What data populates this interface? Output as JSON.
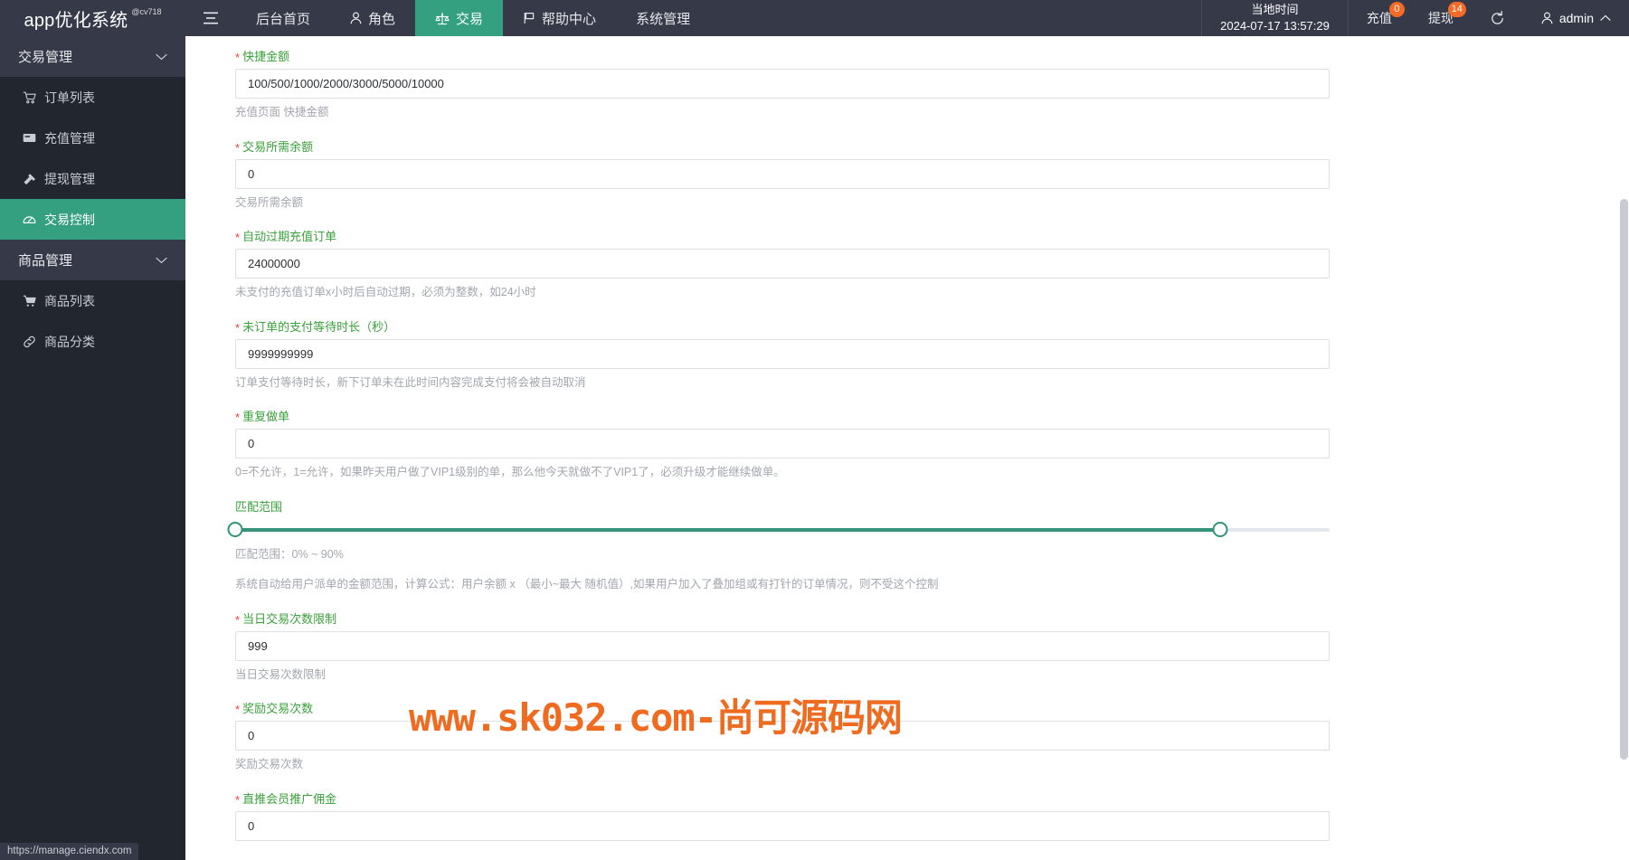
{
  "header": {
    "brand_title": "app优化系统",
    "brand_sup": "@cv718",
    "menu_icon": "hamburger-icon",
    "nav": [
      {
        "label": "后台首页",
        "icon": "",
        "active": false
      },
      {
        "label": "角色",
        "icon": "user-icon",
        "active": false
      },
      {
        "label": "交易",
        "icon": "scales-icon",
        "active": true
      },
      {
        "label": "帮助中心",
        "icon": "flag-icon",
        "active": false
      },
      {
        "label": "系统管理",
        "icon": "",
        "active": false
      }
    ],
    "clock_label": "当地时间",
    "clock_value": "2024-07-17 13:57:29",
    "recharge_label": "充值",
    "recharge_badge": "0",
    "withdraw_label": "提现",
    "withdraw_badge": "14",
    "refresh_icon": "refresh-icon",
    "user_label": "admin",
    "accent": "#35a07f",
    "badge_color": "#f56a24",
    "bar_color": "#363a48"
  },
  "sidebar": {
    "groups": [
      {
        "label": "交易管理",
        "items": [
          {
            "label": "订单列表",
            "icon": "cart-icon",
            "active": false
          },
          {
            "label": "充值管理",
            "icon": "card-icon",
            "active": false
          },
          {
            "label": "提现管理",
            "icon": "hammer-icon",
            "active": false
          },
          {
            "label": "交易控制",
            "icon": "gauge-icon",
            "active": true
          }
        ]
      },
      {
        "label": "商品管理",
        "items": [
          {
            "label": "商品列表",
            "icon": "cart-filled-icon",
            "active": false
          },
          {
            "label": "商品分类",
            "icon": "link-icon",
            "active": false
          }
        ]
      }
    ]
  },
  "form": {
    "fields": [
      {
        "type": "input",
        "required": true,
        "label": "快捷金额",
        "value": "100/500/1000/2000/3000/5000/10000",
        "help": "充值页面 快捷金额"
      },
      {
        "type": "input",
        "required": true,
        "label": "交易所需余额",
        "value": "0",
        "help": "交易所需余额"
      },
      {
        "type": "input",
        "required": true,
        "label": "自动过期充值订单",
        "value": "24000000",
        "help": "未支付的充值订单x小时后自动过期，必须为整数，如24小时"
      },
      {
        "type": "input",
        "required": true,
        "label": "未订单的支付等待时长（秒）",
        "value": "9999999999",
        "help": "订单支付等待时长，新下订单未在此时间内容完成支付将会被自动取消"
      },
      {
        "type": "input",
        "required": true,
        "label": "重复做单",
        "value": "0",
        "help": "0=不允许，1=允许，如果昨天用户做了VIP1级别的单，那么他今天就做不了VIP1了，必须升级才能继续做单。"
      },
      {
        "type": "slider",
        "required": false,
        "label": "匹配范围",
        "range_min": 0,
        "range_max": 90,
        "range_text": "匹配范围：0% ~ 90%",
        "help": "系统自动给用户派单的金额范围，计算公式：用户余额 x （最小~最大 随机值）,如果用户加入了叠加组或有打针的订单情况，则不受这个控制"
      },
      {
        "type": "input",
        "required": true,
        "label": "当日交易次数限制",
        "value": "999",
        "help": "当日交易次数限制"
      },
      {
        "type": "input",
        "required": true,
        "label": "奖励交易次数",
        "value": "0",
        "help": "奖励交易次数"
      },
      {
        "type": "input",
        "required": true,
        "label": "直推会员推广佣金",
        "value": "0",
        "help": ""
      }
    ]
  },
  "watermark": {
    "text": "www.sk032.com-尚可源码网",
    "color": "#ee6b20"
  },
  "statusbar": {
    "url": "https://manage.ciendx.com"
  }
}
